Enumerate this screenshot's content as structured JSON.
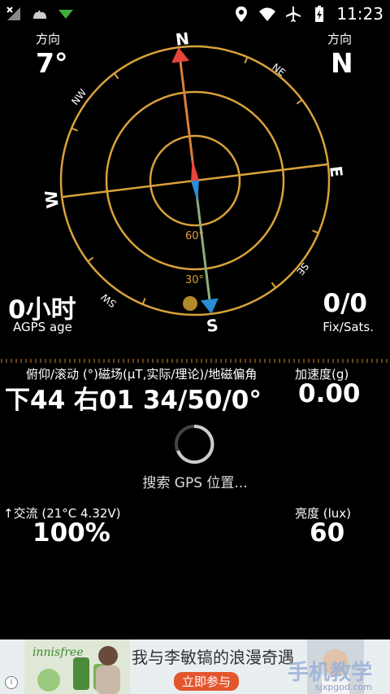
{
  "statusbar": {
    "time": "11:23",
    "left_icons": [
      "signal-off-icon",
      "cat-icon",
      "download-arrow-icon"
    ],
    "right_icons": [
      "location-pin-icon",
      "wifi-icon",
      "airplane-icon",
      "battery-charging-icon"
    ]
  },
  "heading": {
    "left_label": "方向",
    "left_value": "7°",
    "right_label": "方向",
    "right_value": "N"
  },
  "compass": {
    "cardinals": {
      "n": "N",
      "e": "E",
      "s": "S",
      "w": "W"
    },
    "intercardinals": {
      "ne": "NE",
      "se": "SE",
      "sw": "SW",
      "nw": "NW"
    },
    "ring_labels": {
      "inner": "60°",
      "outer": "30°"
    },
    "heading_deg": 7,
    "colors": {
      "ring": "#d9a23a",
      "north": "#e8453c",
      "south": "#2b8cd6",
      "needle_n": "#d9803a",
      "needle_s": "#8fae7a"
    }
  },
  "agps": {
    "value": "0小时",
    "label": "AGPS age"
  },
  "fix": {
    "value": "0/0",
    "label": "Fix/Sats."
  },
  "orientation": {
    "header": "俯仰/滚动 (°)磁场(μT,实际/理论)/地磁偏角",
    "value": "下44 右01  34/50/0°"
  },
  "acceleration": {
    "label": "加速度(g)",
    "value": "0.00"
  },
  "searching_text": "搜索 GPS 位置...",
  "battery": {
    "label": "↑交流 (21°C 4.32V)",
    "value": "100%"
  },
  "brightness": {
    "label": "亮度 (lux)",
    "value": "60"
  },
  "ad": {
    "brand": "innisfree",
    "headline": "我与李敏镐的浪漫奇遇",
    "button": "立即参与",
    "watermark": "手机教学",
    "watermark_url": "sjxpgod.com"
  }
}
